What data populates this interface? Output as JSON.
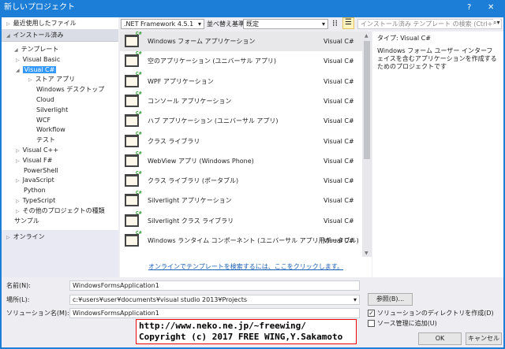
{
  "window": {
    "title": "新しいプロジェクト",
    "help": "?",
    "close": "✕"
  },
  "left": {
    "recent": "最近使用したファイル",
    "installed": "インストール済み",
    "online": "オンライン",
    "tree": [
      {
        "label": "テンプレート",
        "level": 0,
        "arrow": "◢"
      },
      {
        "label": "Visual Basic",
        "level": 1,
        "arrow": "▷"
      },
      {
        "label": "Visual C#",
        "level": 1,
        "arrow": "◢",
        "selected": true
      },
      {
        "label": "ストア アプリ",
        "level": 2,
        "arrow": "▷"
      },
      {
        "label": "Windows デスクトップ",
        "level": 2
      },
      {
        "label": "Cloud",
        "level": 2
      },
      {
        "label": "Silverlight",
        "level": 2
      },
      {
        "label": "WCF",
        "level": 2
      },
      {
        "label": "Workflow",
        "level": 2
      },
      {
        "label": "テスト",
        "level": 2
      },
      {
        "label": "Visual C++",
        "level": 1,
        "arrow": "▷"
      },
      {
        "label": "Visual F#",
        "level": 1,
        "arrow": "▷"
      },
      {
        "label": "PowerShell",
        "level": 1
      },
      {
        "label": "JavaScript",
        "level": 1,
        "arrow": "▷"
      },
      {
        "label": "Python",
        "level": 1
      },
      {
        "label": "TypeScript",
        "level": 1,
        "arrow": "▷"
      },
      {
        "label": "その他のプロジェクトの種類",
        "level": 1,
        "arrow": "▷"
      },
      {
        "label": "サンプル",
        "level": 0
      }
    ]
  },
  "toolbar": {
    "framework": ".NET Framework 4.5.1",
    "sort_label": "並べ替え基準:",
    "sort_value": "既定",
    "search_placeholder": "インストール済み テンプレート の検索 (Ctrl+E)"
  },
  "templates": [
    {
      "name": "Windows フォーム アプリケーション",
      "type": "Visual C#",
      "selected": true
    },
    {
      "name": "空のアプリケーション (ユニバーサル アプリ)",
      "type": "Visual C#"
    },
    {
      "name": "WPF アプリケーション",
      "type": "Visual C#"
    },
    {
      "name": "コンソール アプリケーション",
      "type": "Visual C#"
    },
    {
      "name": "ハブ アプリケーション (ユニバーサル アプリ)",
      "type": "Visual C#"
    },
    {
      "name": "クラス ライブラリ",
      "type": "Visual C#"
    },
    {
      "name": "WebView アプリ (Windows Phone)",
      "type": "Visual C#"
    },
    {
      "name": "クラス ライブラリ (ポータブル)",
      "type": "Visual C#"
    },
    {
      "name": "Silverlight アプリケーション",
      "type": "Visual C#"
    },
    {
      "name": "Silverlight クラス ライブラリ",
      "type": "Visual C#"
    },
    {
      "name": "Windows ランタイム コンポーネント (ユニバーサル アプリ用ポータブル)",
      "type": "Visual C#"
    }
  ],
  "online_link": "オンラインでテンプレートを検索するには、ここをクリックします。",
  "details": {
    "type": "タイプ:  Visual C#",
    "description": "Windows フォーム ユーザー インターフェイスを含むアプリケーションを作成するためのプロジェクトです"
  },
  "form": {
    "name_label": "名前(N):",
    "name_value": "WindowsFormsApplication1",
    "location_label": "場所(L):",
    "location_value": "c:¥users¥user¥documents¥visual studio 2013¥Projects",
    "solution_label": "ソリューション名(M):",
    "solution_value": "WindowsFormsApplication1",
    "browse": "参照(B)...",
    "create_dir": "ソリューションのディレクトリを作成(D)",
    "create_dir_checked": true,
    "source_control": "ソース管理に追加(U)",
    "source_control_checked": false,
    "ok": "OK",
    "cancel": "キャンセル"
  },
  "watermark": {
    "line1": "http://www.neko.ne.jp/~freewing/",
    "line2": "Copyright (c) 2017 FREE WING,Y.Sakamoto"
  }
}
